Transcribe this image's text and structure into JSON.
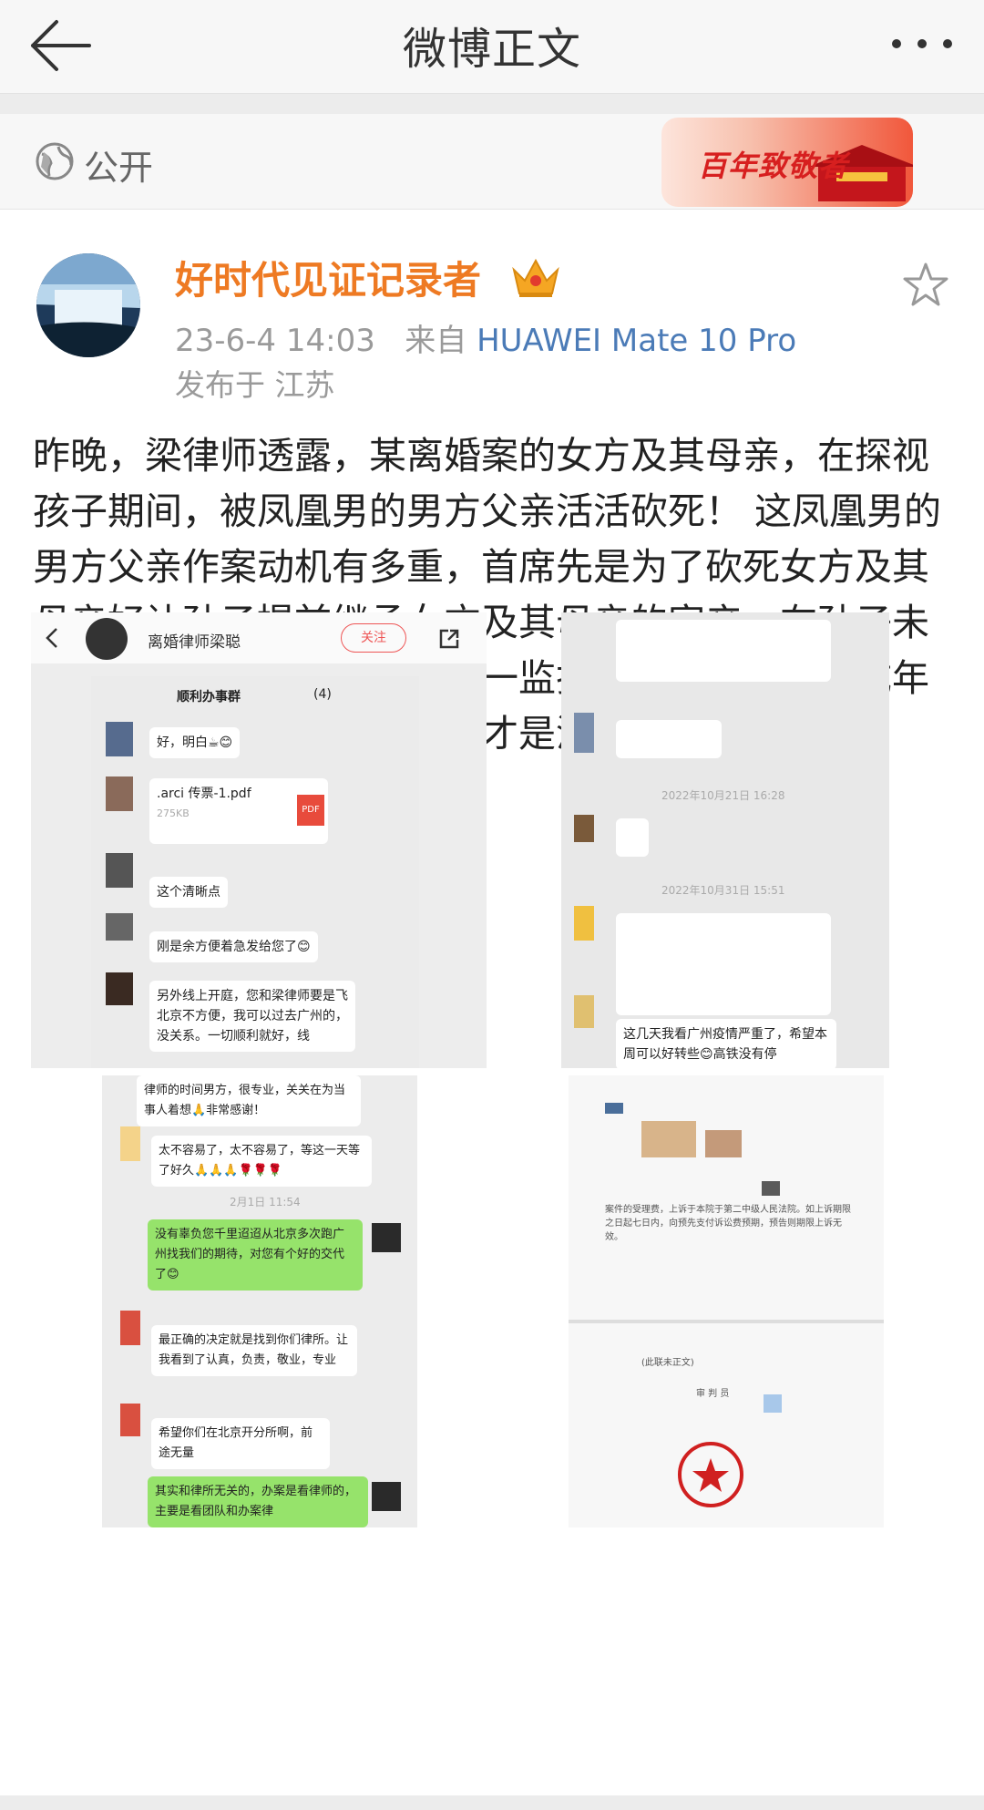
{
  "header": {
    "title": "微博正文",
    "back_icon": "back-arrow-icon",
    "more_icon": "more-dots-icon"
  },
  "visibility": {
    "label": "公开",
    "icon": "globe-icon",
    "banner_text": "百年致敬者"
  },
  "post": {
    "username": "好时代见证记录者",
    "badge_icon": "crown-icon",
    "timestamp": "23-6-4 14:03",
    "source_prefix": "来自",
    "device": "HUAWEI Mate 10 Pro",
    "location": "发布于 江苏",
    "text": "昨晚，梁律师透露，某离婚案的女方及其母亲，在探视孩子期间，被凤凰男的男方父亲活活砍死！ 这凤凰男的男方父亲作案动机有多重，首席先是为了砍死女方及其母亲好让孙子提前继承女方及其母亲的家产，在孙子未成年前，凤凰男儿子作为唯一监护人自然能在孩子成年前处置享受女方财产，其次才是泄愤。"
  },
  "image1": {
    "account_name": "离婚律师梁聪",
    "follow_label": "关注",
    "group_title": "顺利办事群",
    "group_count": "(4)",
    "msgs": [
      "好，明白☕😊",
      ".arci     传票-1.pdf",
      "275KB",
      "这个清晰点",
      "刚是余方便着急发给您了😊",
      "另外线上开庭，您和梁律师要是飞北京不方便，我可以过去广州的，没关系。一切顺利就好，线"
    ],
    "pdf_label": "PDF"
  },
  "image2": {
    "time1": "2022年10月21日 16:28",
    "time2": "2022年10月31日 15:51",
    "msg": "这几天我看广州疫情严重了，希望本周可以好转些😊高铁没有停"
  },
  "image3": {
    "msg_top": "律师的时间男方，很专业，关关在为当事人着想🙏非常感谢！",
    "msg_a": "太不容易了，太不容易了，等这一天等了好久🙏🙏🙏🌹🌹🌹",
    "time": "2月1日 11:54",
    "msg_b": "没有辜负您千里迢迢从北京多次跑广州找我们的期待，对您有个好的交代了😊",
    "msg_c": "最正确的决定就是找到你们律所。让我看到了认真，负责，敬业，专业",
    "msg_d": "希望你们在北京开分所啊，前途无量",
    "msg_e": "其实和律所无关的，办案是看律师的，主要是看团队和办案律"
  },
  "image4": {
    "doc_text": "案件的受理费，上诉于本院于第二中级人民法院。如上诉期限之日起七日内，向预先支付诉讼费预期，预告则期限上诉无效。",
    "doc_label": "(此联未正文)",
    "sign": "审 判 员"
  },
  "colors": {
    "username": "#ee7a23",
    "device_link": "#4b7bb7",
    "meta": "#9a9a9a",
    "chat_green": "#96e36b",
    "banner_red": "#d71f1f"
  }
}
